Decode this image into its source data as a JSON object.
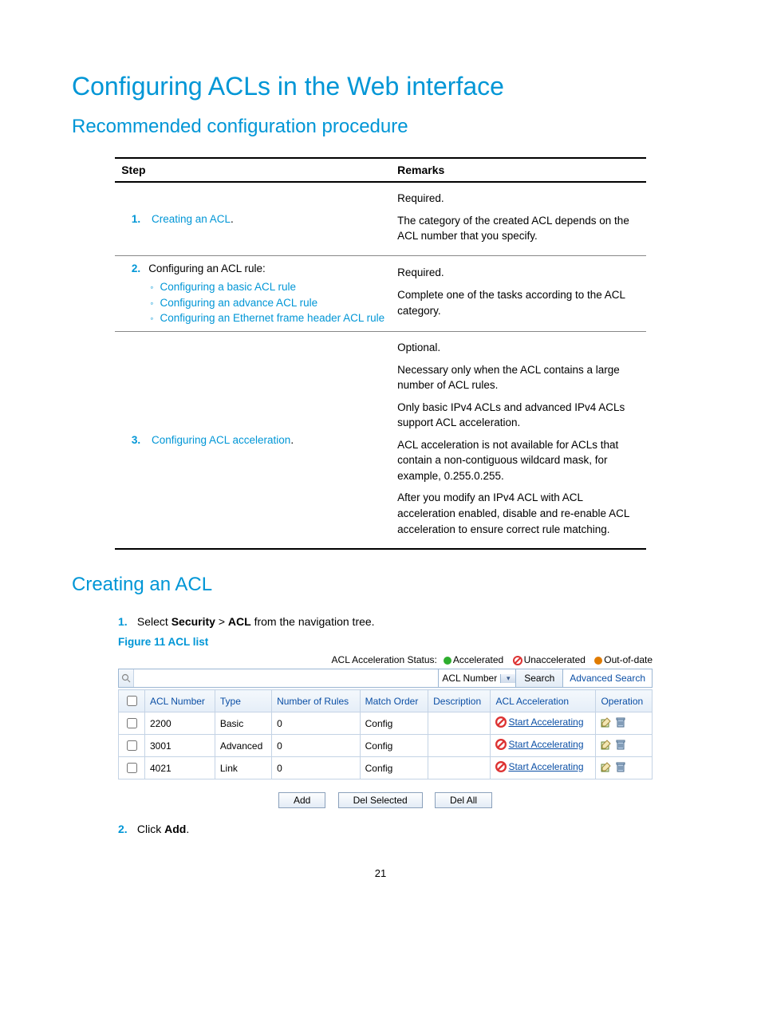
{
  "page_number": "21",
  "h1": "Configuring ACLs in the Web interface",
  "h2_procedure": "Recommended configuration procedure",
  "proc_table": {
    "head_step": "Step",
    "head_remarks": "Remarks",
    "rows": [
      {
        "num": "1.",
        "step_link": "Creating an ACL",
        "step_suffix": ".",
        "remarks": [
          "Required.",
          "The category of the created ACL depends on the ACL number that you specify."
        ]
      },
      {
        "num": "2.",
        "step_intro": "Configuring an ACL rule:",
        "sub_links": [
          "Configuring a basic ACL rule",
          "Configuring an advance ACL rule",
          "Configuring an Ethernet frame header ACL rule"
        ],
        "remarks": [
          "Required.",
          "Complete one of the tasks according to the ACL category."
        ]
      },
      {
        "num": "3.",
        "step_link": "Configuring ACL acceleration",
        "step_suffix": ".",
        "remarks": [
          "Optional.",
          "Necessary only when the ACL contains a large number of ACL rules.",
          "Only basic IPv4 ACLs and advanced IPv4 ACLs support ACL acceleration.",
          "ACL acceleration is not available for ACLs that contain a non-contiguous wildcard mask, for example, 0.255.0.255.",
          "After you modify an IPv4 ACL with ACL acceleration enabled, disable and re-enable ACL acceleration to ensure correct rule matching."
        ]
      }
    ]
  },
  "h2_creating": "Creating an ACL",
  "instructions": [
    {
      "num": "1.",
      "prefix": "Select ",
      "bold1": "Security",
      "mid": " > ",
      "bold2": "ACL",
      "suffix": " from the navigation tree."
    }
  ],
  "figure_caption": "Figure 11 ACL list",
  "acl_panel": {
    "status_label": "ACL Acceleration Status:",
    "status_accel": "Accelerated",
    "status_unaccel": "Unaccelerated",
    "status_ood": "Out-of-date",
    "search": {
      "combo_value": "ACL Number",
      "search_btn": "Search",
      "adv_link": "Advanced Search"
    },
    "headers": [
      "ACL Number",
      "Type",
      "Number of Rules",
      "Match Order",
      "Description",
      "ACL Acceleration",
      "Operation"
    ],
    "rows": [
      {
        "num": "2200",
        "type": "Basic",
        "rules": "0",
        "order": "Config",
        "desc": "",
        "accel": "Start Accelerating"
      },
      {
        "num": "3001",
        "type": "Advanced",
        "rules": "0",
        "order": "Config",
        "desc": "",
        "accel": "Start Accelerating"
      },
      {
        "num": "4021",
        "type": "Link",
        "rules": "0",
        "order": "Config",
        "desc": "",
        "accel": "Start Accelerating"
      }
    ],
    "buttons": {
      "add": "Add",
      "del_sel": "Del Selected",
      "del_all": "Del All"
    }
  },
  "instruction2": {
    "num": "2.",
    "prefix": "Click ",
    "bold1": "Add",
    "suffix": "."
  }
}
